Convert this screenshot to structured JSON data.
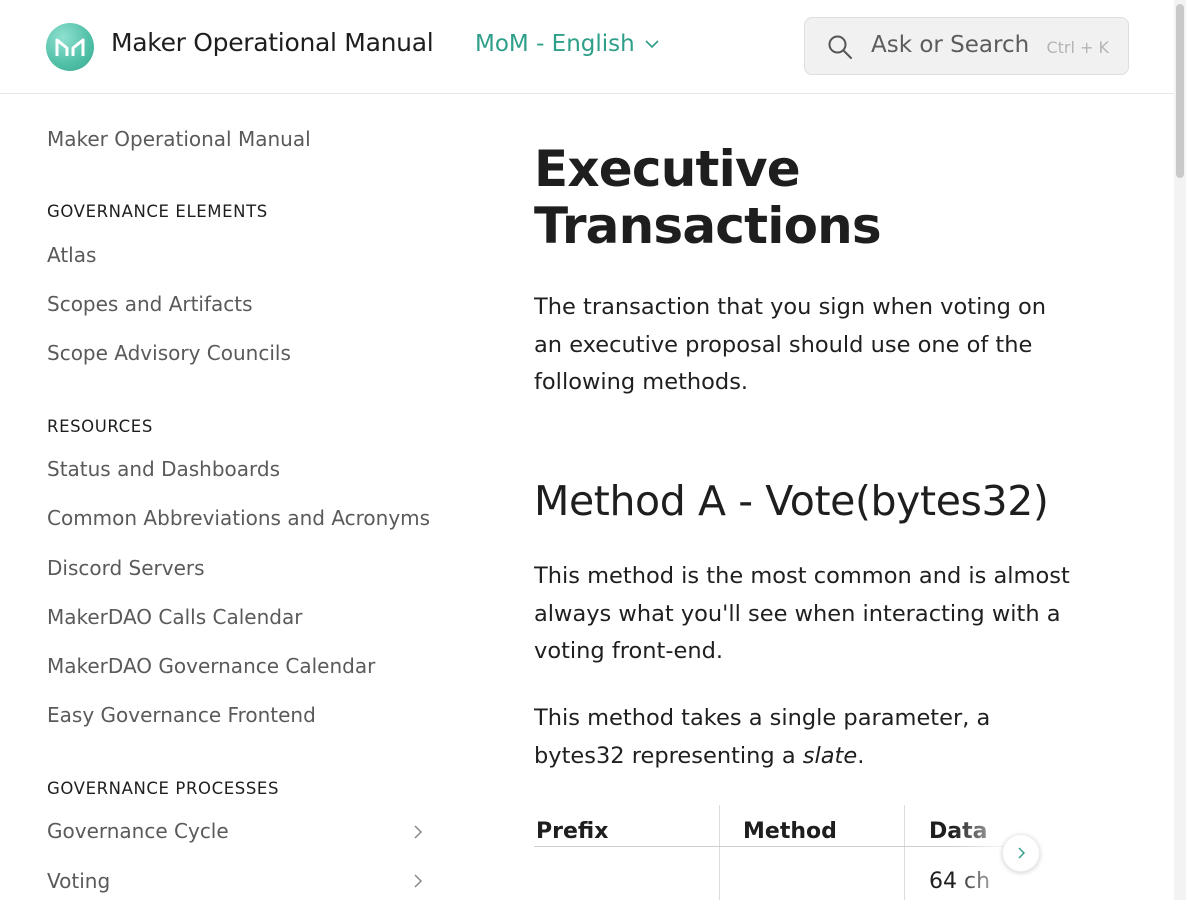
{
  "header": {
    "site_title": "Maker Operational Manual",
    "space_switcher_label": "MoM - English",
    "search_placeholder": "Ask or Search",
    "search_shortcut": "Ctrl + K",
    "logo_icon": "maker-logo-icon",
    "brand_color": "#4fbfa6",
    "accent_color": "#2f9f89"
  },
  "sidebar": {
    "top_link": "Maker Operational Manual",
    "sections": [
      {
        "heading": "GOVERNANCE ELEMENTS",
        "items": [
          "Atlas",
          "Scopes and Artifacts",
          "Scope Advisory Councils"
        ]
      },
      {
        "heading": "RESOURCES",
        "items": [
          "Status and Dashboards",
          "Common Abbreviations and Acronyms",
          "Discord Servers",
          "MakerDAO Calls Calendar",
          "MakerDAO Governance Calendar",
          "Easy Governance Frontend"
        ]
      },
      {
        "heading": "GOVERNANCE PROCESSES",
        "items": [
          "Governance Cycle",
          "Voting"
        ]
      }
    ]
  },
  "main": {
    "title_line1": "Executive",
    "title_line2": "Transactions",
    "intro": "The transaction that you sign when voting on an executive proposal should use one of the following methods.",
    "section_heading": "Method A - Vote(bytes32)",
    "para1": "This method is the most common and is almost always what you'll see when interacting with a voting front-end.",
    "para2_prefix": "This method takes a single parameter, a bytes32 representing a ",
    "para2_emphasis": "slate",
    "para2_suffix": ".",
    "table": {
      "headers": [
        "Prefix",
        "Method",
        "Data"
      ],
      "row1": [
        "",
        "",
        "64 ch"
      ]
    }
  }
}
